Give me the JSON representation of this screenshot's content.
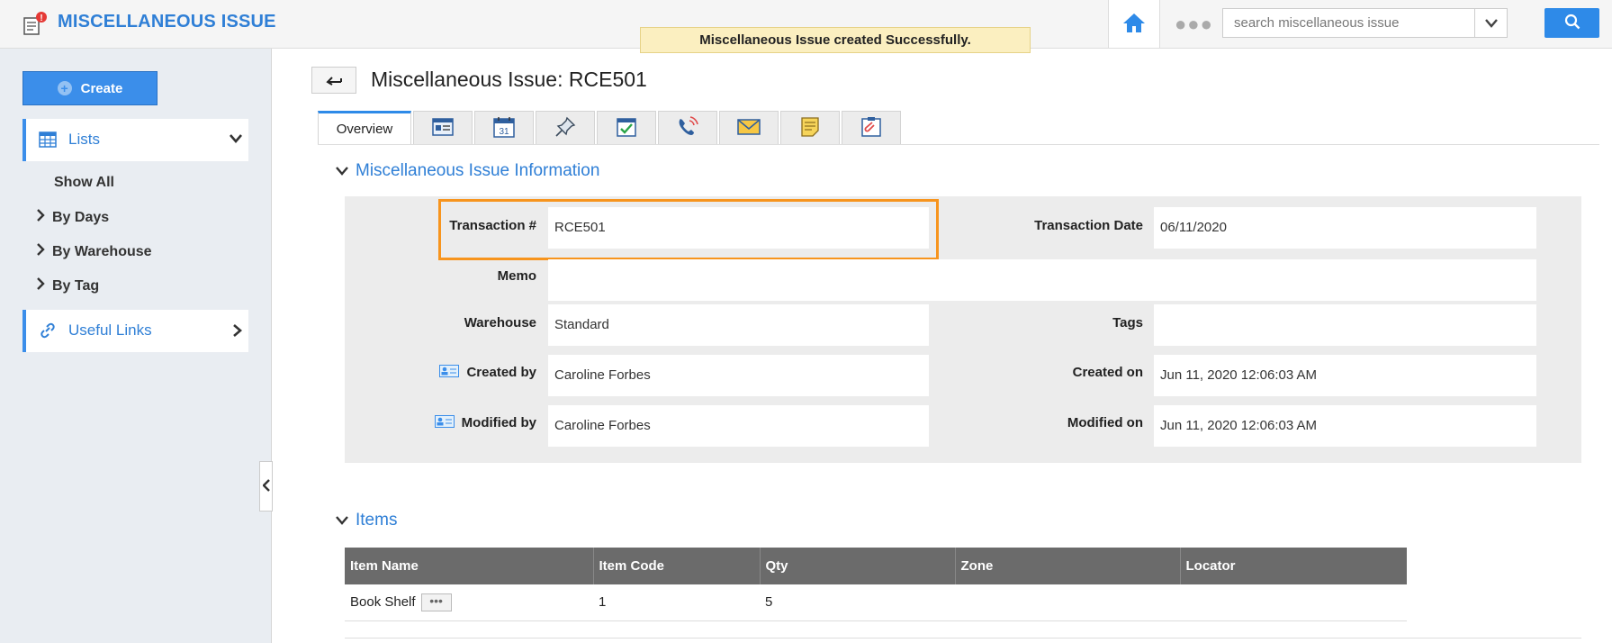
{
  "app": {
    "title": "MISCELLANEOUS ISSUE"
  },
  "toast": {
    "message": "Miscellaneous Issue created Successfully."
  },
  "search": {
    "placeholder": "search miscellaneous issue",
    "value": ""
  },
  "sidebar": {
    "create_label": "Create",
    "lists_label": "Lists",
    "links": [
      {
        "label": "Show All"
      },
      {
        "label": "By Days"
      },
      {
        "label": "By Warehouse"
      },
      {
        "label": "By Tag"
      }
    ],
    "useful_links_label": "Useful Links"
  },
  "page": {
    "title": "Miscellaneous Issue: RCE501"
  },
  "tabs": {
    "overview_label": "Overview",
    "icons": [
      "card-icon",
      "calendar-icon",
      "pin-icon",
      "checklist-icon",
      "phone-icon",
      "mail-icon",
      "note-icon",
      "attachment-icon"
    ],
    "calendar_day": "31"
  },
  "info": {
    "section_title": "Miscellaneous Issue Information",
    "transaction_no_label": "Transaction #",
    "transaction_no": "RCE501",
    "transaction_date_label": "Transaction Date",
    "transaction_date": "06/11/2020",
    "memo_label": "Memo",
    "memo": "",
    "warehouse_label": "Warehouse",
    "warehouse": "Standard",
    "tags_label": "Tags",
    "tags": "",
    "created_by_label": "Created by",
    "created_by": "Caroline Forbes",
    "created_on_label": "Created on",
    "created_on": "Jun 11, 2020 12:06:03 AM",
    "modified_by_label": "Modified by",
    "modified_by": "Caroline Forbes",
    "modified_on_label": "Modified on",
    "modified_on": "Jun 11, 2020 12:06:03 AM"
  },
  "items": {
    "section_title": "Items",
    "columns": [
      "Item Name",
      "Item Code",
      "Qty",
      "Zone",
      "Locator"
    ],
    "rows": [
      {
        "item_name": "Book Shelf",
        "item_code": "1",
        "qty": "5",
        "zone": "",
        "locator": ""
      }
    ]
  },
  "colors": {
    "accent": "#2f7fd6",
    "button": "#2e8ae8",
    "highlight": "#f7941d",
    "toast_bg": "#fbefc0",
    "table_header": "#6b6b6b"
  }
}
